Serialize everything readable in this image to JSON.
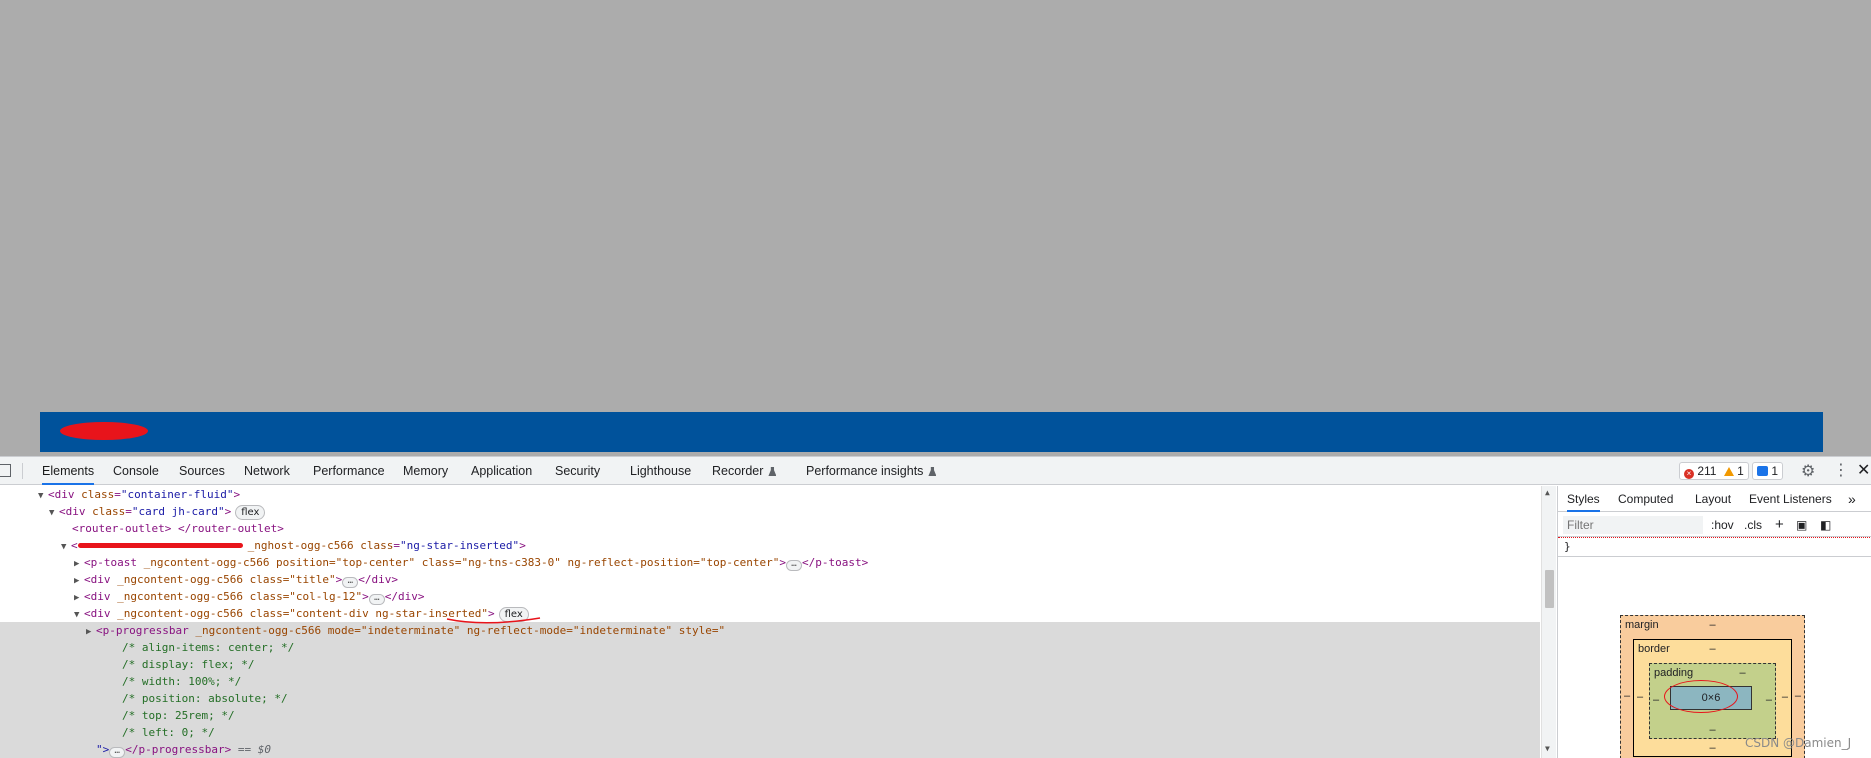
{
  "page": {
    "banner_label": "",
    "banner_color": "#00529b",
    "backdrop_color": "#acacac"
  },
  "devtools": {
    "tabs": [
      {
        "label": "Elements",
        "active": true
      },
      {
        "label": "Console"
      },
      {
        "label": "Sources"
      },
      {
        "label": "Network"
      },
      {
        "label": "Performance"
      },
      {
        "label": "Memory"
      },
      {
        "label": "Application"
      },
      {
        "label": "Security"
      },
      {
        "label": "Lighthouse"
      },
      {
        "label": "Recorder",
        "icon": "flask-icon"
      },
      {
        "label": "Performance insights",
        "icon": "flask-icon"
      }
    ],
    "errors_count": "211",
    "warnings_count": "1",
    "messages_count": "1"
  },
  "elements": {
    "lines": [
      {
        "open": "<div ",
        "attr": "class",
        "val": "\"container-fluid\"",
        "close": ">"
      },
      {
        "open": "<div ",
        "attr": "class",
        "val": "\"card jh-card\"",
        "close": ">",
        "pill": "flex"
      },
      {
        "text": "<router-outlet> </router-outlet>"
      },
      {
        "open": "<",
        "mid": "_nghost-ogg-c566 ",
        "attr": "class",
        "val": "\"ng-star-inserted\"",
        "close": ">"
      },
      {
        "open": "<p-toast ",
        "mid": "_ngcontent-ogg-c566 position=\"top-center\" class=\"ng-tns-c383-0\" ng-reflect-position=\"top-center\"",
        "close": "</p-toast>"
      },
      {
        "open": "<div ",
        "mid": "_ngcontent-ogg-c566 class=\"title\"",
        "close": "</div>"
      },
      {
        "open": "<div ",
        "mid": "_ngcontent-ogg-c566 class=\"col-lg-12\"",
        "close": "</div>"
      },
      {
        "open": "<div ",
        "mid": "_ngcontent-ogg-c566 class=\"content-div ng-star-inserted\"",
        "close": ">",
        "pill": "flex"
      },
      {
        "open": "<p-progressbar ",
        "mid": "_ngcontent-ogg-c566 mode=\"indeterminate\" ng-reflect-mode=\"indeterminate\" style=\""
      },
      {
        "comment": "/* align-items: center; */"
      },
      {
        "comment": "/* display: flex; */"
      },
      {
        "comment": "/* width: 100%; */"
      },
      {
        "comment": "/* position: absolute; */"
      },
      {
        "comment": "/* top: 25rem; */"
      },
      {
        "comment": "/* left: 0; */"
      },
      {
        "text": "\">",
        "close": "</p-progressbar>",
        "suffix": " == $0"
      }
    ]
  },
  "styles_pane": {
    "tabs": [
      {
        "label": "Styles",
        "active": true
      },
      {
        "label": "Computed"
      },
      {
        "label": "Layout"
      },
      {
        "label": "Event Listeners"
      }
    ],
    "filter_placeholder": "Filter",
    "hov_label": ":hov",
    "cls_label": ".cls",
    "brace": "}",
    "box_model": {
      "margin_label": "margin",
      "border_label": "border",
      "padding_label": "padding",
      "content_size": "0×6",
      "dash": "–"
    }
  },
  "watermark": "CSDN @Damien_J",
  "colors": {
    "tag": "#881280",
    "attr": "#994500",
    "value": "#1a1aa6",
    "comment": "#236e25",
    "accent": "#1a73e8",
    "error": "#d93025",
    "warning": "#f29900",
    "annotation_red": "#e8141b"
  }
}
